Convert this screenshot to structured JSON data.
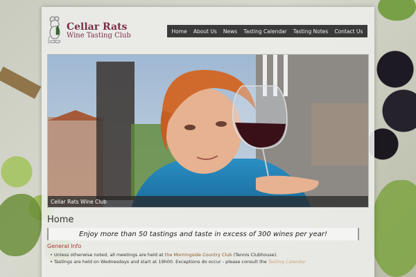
{
  "site": {
    "title": "Cellar Rats",
    "subtitle": "Wine Tasting Club"
  },
  "nav": {
    "items": [
      {
        "label": "Home"
      },
      {
        "label": "About Us"
      },
      {
        "label": "News"
      },
      {
        "label": "Tasting Calendar"
      },
      {
        "label": "Tasting Notes"
      },
      {
        "label": "Contact Us"
      }
    ]
  },
  "hero": {
    "caption": "Cellar Rats Wine Club"
  },
  "content": {
    "page_title": "Home",
    "tagline": "Enjoy more than 50 tastings and taste in excess of 300 wines per year!",
    "section_heading": "General Info",
    "info": {
      "line1_prefix": "Unless otherwise noted, all meetings are held at ",
      "line1_link": "the Morningside Country Club",
      "line1_suffix": " (Tennis Clubhouse).",
      "line2_prefix": "Tastings are held on Wednesdays and start at 19h00. Exceptions do occur - please consult the ",
      "line2_link": "Tasting Calendar"
    }
  },
  "colors": {
    "brand": "#7a2e4a",
    "nav_bg": "#3a3a3a",
    "section_heading": "#aa3333",
    "link": "#8a5a2a"
  }
}
